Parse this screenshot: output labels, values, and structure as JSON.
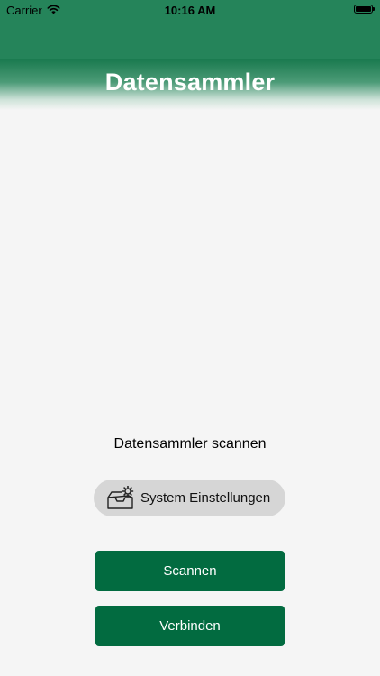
{
  "status_bar": {
    "carrier": "Carrier",
    "time": "10:16 AM",
    "wifi_icon": "wifi-icon",
    "battery_icon": "battery-icon"
  },
  "header": {
    "title": "Datensammler"
  },
  "main": {
    "scan_label": "Datensammler scannen",
    "settings_button": {
      "label": "System Einstellungen",
      "icon": "tray-gear-icon"
    },
    "scan_button_label": "Scannen",
    "connect_button_label": "Verbinden"
  },
  "colors": {
    "header": "#25845a",
    "primary_button": "#026b40",
    "settings_button": "#d6d6d6",
    "background": "#f5f5f5"
  }
}
